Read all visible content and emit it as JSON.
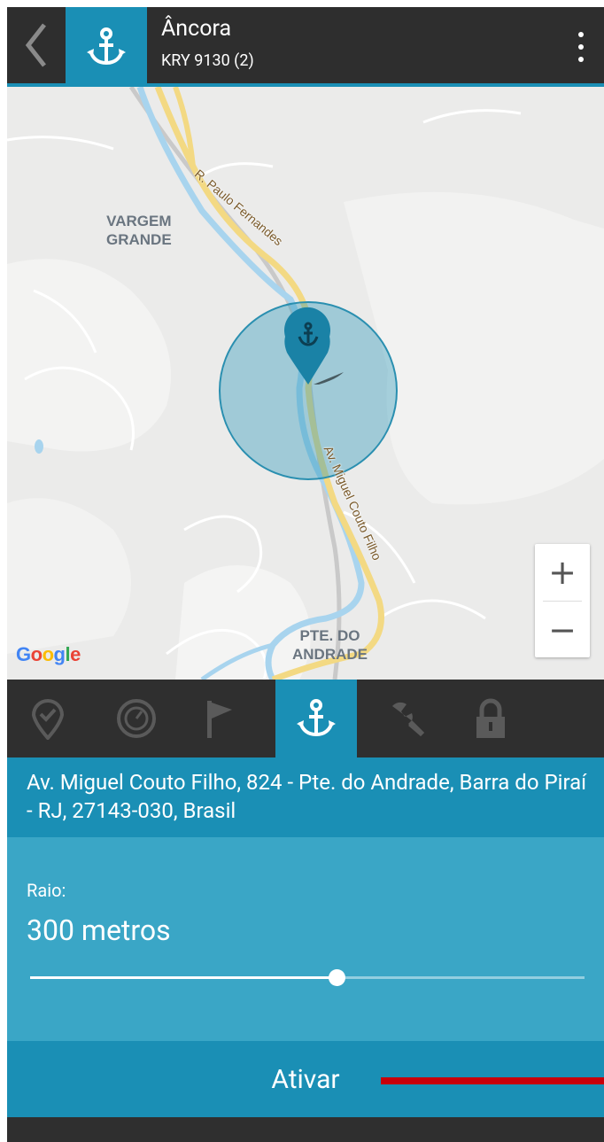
{
  "header": {
    "title": "Âncora",
    "subtitle": "KRY 9130 (2)"
  },
  "map": {
    "labels": {
      "vargem": "VARGEM\nGRANDE",
      "pte": "PTE. DO\nANDRADE"
    },
    "streets": {
      "paulo": "R. Paulo Fernandes",
      "miguel": "Av. Miguel Couto Filho"
    },
    "zoom_in": "+",
    "zoom_out": "−",
    "attribution": "Google"
  },
  "tabs": [
    {
      "icon": "location-check-icon",
      "active": false
    },
    {
      "icon": "speed-clock-icon",
      "active": false
    },
    {
      "icon": "flag-icon",
      "active": false
    },
    {
      "icon": "anchor-icon",
      "active": true
    },
    {
      "icon": "wrench-icon",
      "active": false
    },
    {
      "icon": "lock-icon",
      "active": false
    }
  ],
  "address": "Av. Miguel Couto Filho, 824 - Pte. do Andrade, Barra do Piraí - RJ, 27143-030, Brasil",
  "radius": {
    "label": "Raio:",
    "value_text": "300 metros",
    "slider_fraction": 0.553
  },
  "activate_button": "Ativar",
  "colors": {
    "accent": "#1a8fb5",
    "panel": "#3aa6c6",
    "header_bg": "#2e2e2e",
    "mark_red": "#c8000a"
  }
}
